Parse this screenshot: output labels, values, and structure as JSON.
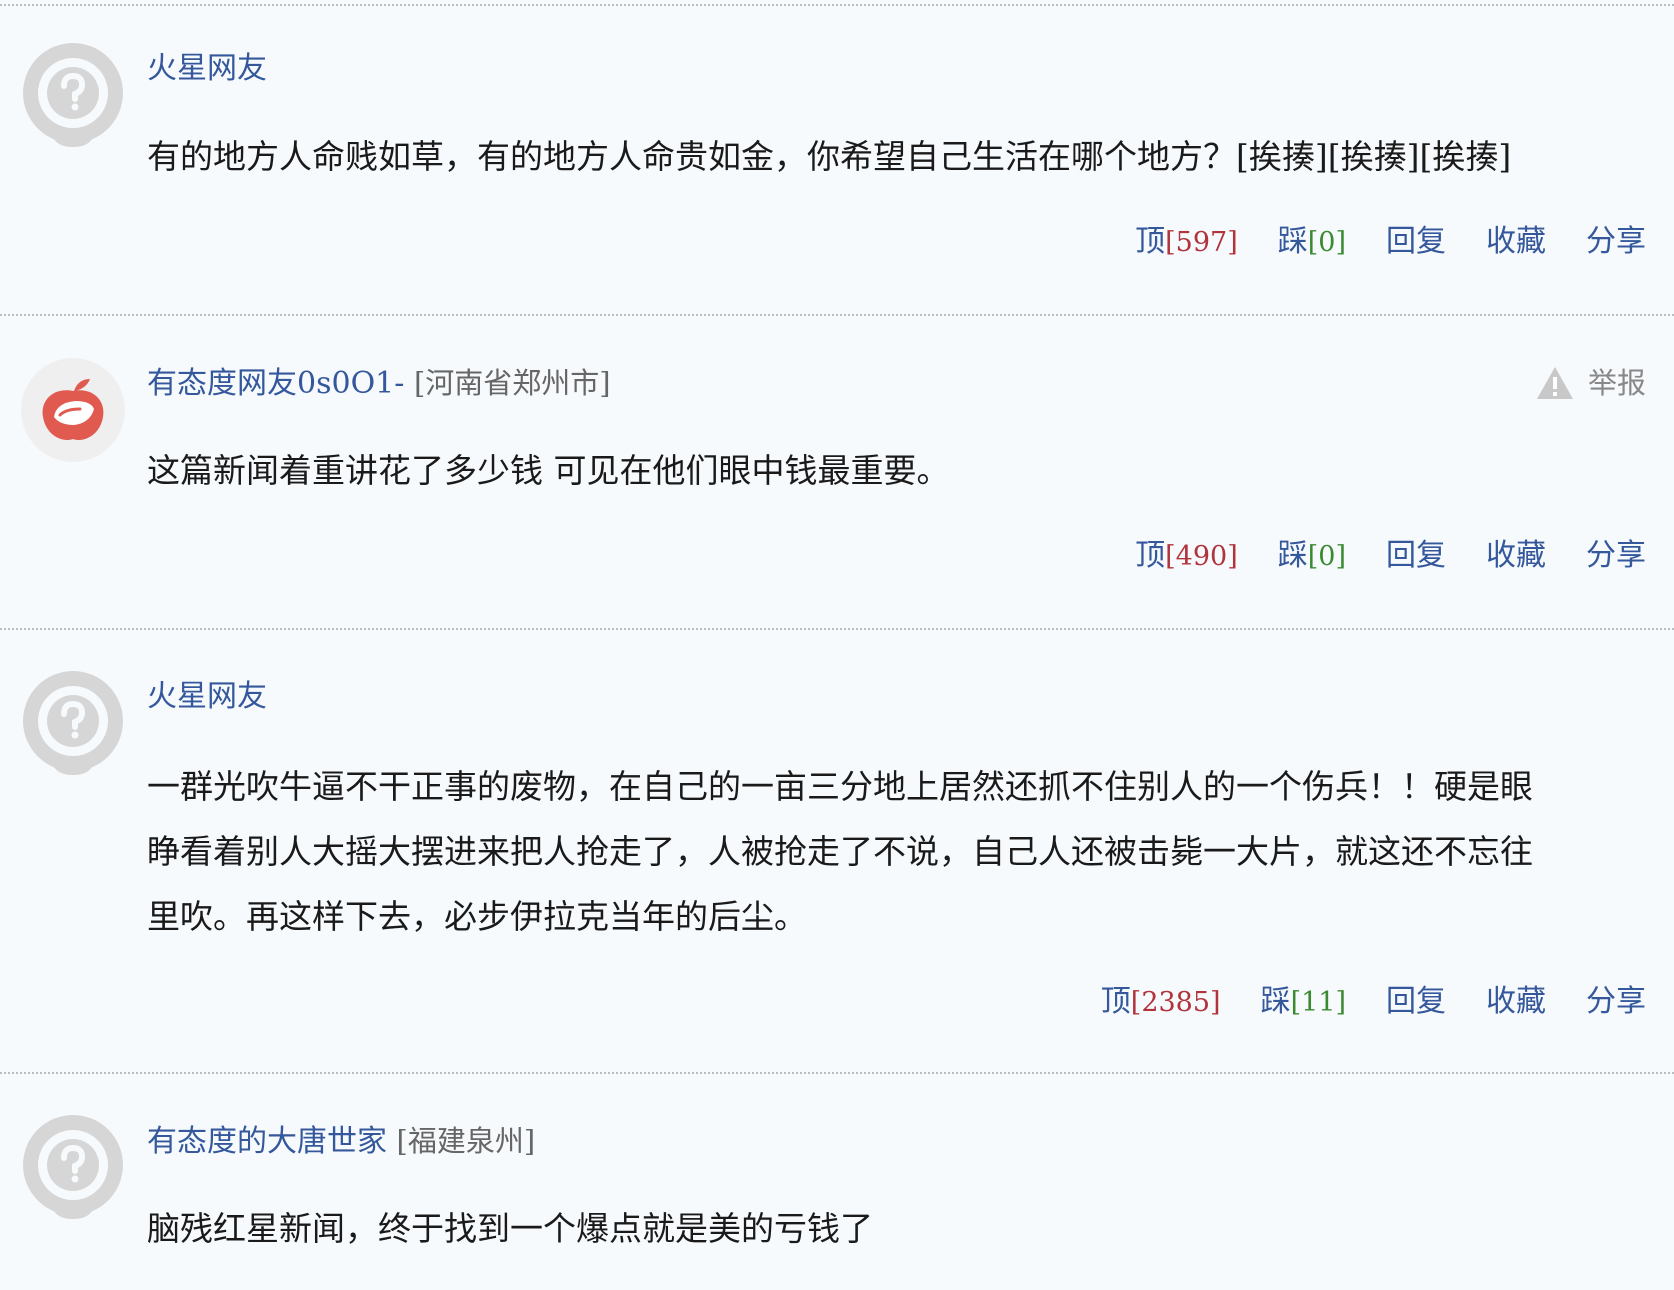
{
  "comments": [
    {
      "username": "火星网友",
      "location": "",
      "content_lines": [
        "有的地方人命贱如草，有的地方人命贵如金，你希望自己生活在哪个地方？[挨揍][挨揍][挨揍]"
      ],
      "actions": {
        "up_label": "顶",
        "up_count": "[597]",
        "down_label": "踩",
        "down_count": "[0]",
        "reply": "回复",
        "collect": "收藏",
        "share": "分享"
      }
    },
    {
      "username": "有态度网友0s0O1-",
      "location": "[河南省郑州市]",
      "report_label": "举报",
      "content_lines": [
        "这篇新闻着重讲花了多少钱 可见在他们眼中钱最重要。"
      ],
      "actions": {
        "up_label": "顶",
        "up_count": "[490]",
        "down_label": "踩",
        "down_count": "[0]",
        "reply": "回复",
        "collect": "收藏",
        "share": "分享"
      }
    },
    {
      "username": "火星网友",
      "location": "",
      "content_lines": [
        "一群光吹牛逼不干正事的废物，在自己的一亩三分地上居然还抓不住别人的一个伤兵！！硬是眼",
        "睁看着别人大摇大摆进来把人抢走了，人被抢走了不说，自己人还被击毙一大片，就这还不忘往",
        "里吹。再这样下去，必步伊拉克当年的后尘。"
      ],
      "actions": {
        "up_label": "顶",
        "up_count": "[2385]",
        "down_label": "踩",
        "down_count": "[11]",
        "reply": "回复",
        "collect": "收藏",
        "share": "分享"
      }
    },
    {
      "username": "有态度的大唐世家",
      "location": "[福建泉州]",
      "content_lines": [
        "脑残红星新闻，终于找到一个爆点就是美的亏钱了"
      ]
    }
  ],
  "icons": {
    "default_avatar": "question-mark-avatar-icon",
    "apple_avatar": "apple-avatar-icon",
    "report": "warning-triangle-icon"
  },
  "colors": {
    "username": "#34589b",
    "up_count": "#b0343c",
    "down_count": "#3a8a32",
    "apple_avatar": "#e05a4f"
  }
}
